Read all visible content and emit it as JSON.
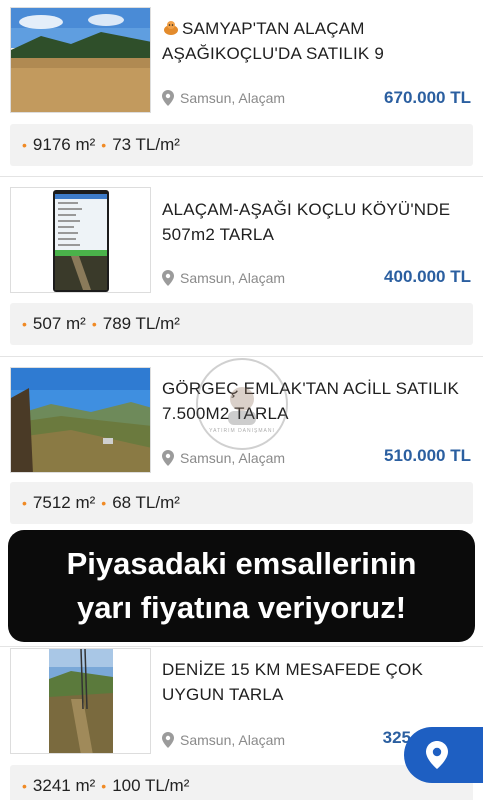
{
  "listings": [
    {
      "title_icon": "cow-emoji",
      "title_line1": "SAMYAP'TAN ALAÇAM",
      "title_line2": "AŞAĞIKOÇLU'DA SATILIK 9",
      "location": "Samsun, Alaçam",
      "price": "670.000 TL",
      "area": "9176 m²",
      "unit_price": "73 TL/m²"
    },
    {
      "title_line1": "ALAÇAM-AŞAĞI KOÇLU KÖYÜ'NDE",
      "title_line2": "507m2 TARLA",
      "location": "Samsun, Alaçam",
      "price": "400.000 TL",
      "area": "507 m²",
      "unit_price": "789 TL/m²"
    },
    {
      "title_line1": "GÖRGEÇ EMLAK'TAN ACİLL SATILIK",
      "title_line2": "7.500M2 TARLA",
      "location": "Samsun, Alaçam",
      "price": "510.000 TL",
      "area": "7512 m²",
      "unit_price": "68 TL/m²"
    },
    {
      "title_line1": "DENİZE 15 KM MESAFEDE ÇOK",
      "title_line2": "UYGUN TARLA",
      "location": "Samsun, Alaçam",
      "price": "325",
      "area": "3241 m²",
      "unit_price": "100 TL/m²"
    }
  ],
  "banner": {
    "line1": "Piyasadaki emsallerinin",
    "line2": "yarı fiyatına veriyoruz!"
  },
  "watermark_text": "YATIRIM DANIŞMANI",
  "colors": {
    "price": "#2b5fa0",
    "accent_dot": "#f08a24",
    "fab": "#1e5fc2",
    "banner_bg": "#0b0b0b"
  }
}
